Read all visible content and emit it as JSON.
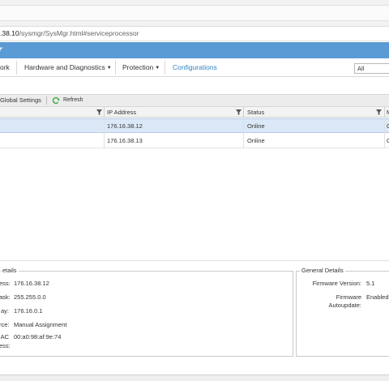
{
  "browser": {
    "address_host": ".38.10",
    "address_path": "/sysmgr/SysMgr.html#serviceprocessor"
  },
  "app": {
    "title": "r"
  },
  "nav": {
    "items": [
      {
        "label": "ork"
      },
      {
        "label": "Hardware and Diagnostics",
        "caret": "▼"
      },
      {
        "label": "Protection",
        "caret": "▼"
      },
      {
        "label": "Configurations"
      }
    ],
    "filter_select": "All"
  },
  "toolbar": {
    "global_settings": "Global Settings",
    "refresh": "Refresh"
  },
  "grid": {
    "columns": [
      "IP Address",
      "Status",
      "M"
    ],
    "rows": [
      {
        "ip": "176.16.38.12",
        "status": "Online",
        "extra": "C",
        "selected": true
      },
      {
        "ip": "176.16.38.13",
        "status": "Online",
        "extra": "C",
        "selected": false
      }
    ]
  },
  "network_details": {
    "title": "etails",
    "fields": [
      {
        "label": "ess:",
        "value": "176.16.38.12"
      },
      {
        "label": "ask:",
        "value": "255.255.0.0"
      },
      {
        "label": "ay:",
        "value": "176.16.0.1"
      },
      {
        "label": "rce:",
        "value": "Manual Assignment"
      },
      {
        "label": "AC",
        "value": "00:a0:98:af:9e:74"
      },
      {
        "label": "ess:",
        "value": ""
      }
    ]
  },
  "general_details": {
    "title": "General Details",
    "fields": [
      {
        "label": "Firmware Version:",
        "value": "5.1"
      },
      {
        "label": "Firmware",
        "value": "Enabled"
      },
      {
        "label": "Autoupdate:",
        "value": ""
      }
    ]
  },
  "colors": {
    "header_blue": "#5b9bd5",
    "active_link": "#2e86c1",
    "selected_row": "#dbe8f8",
    "refresh_green": "#4caf50"
  }
}
